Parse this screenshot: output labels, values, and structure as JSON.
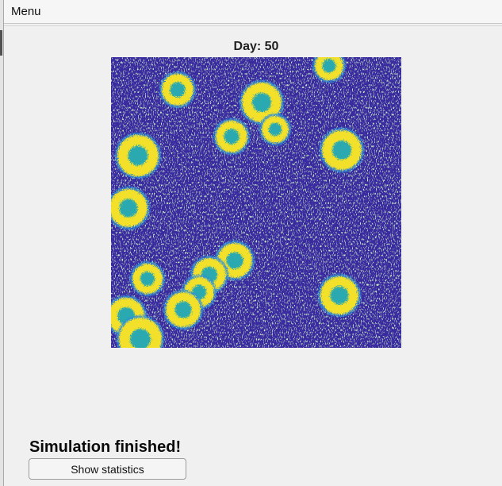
{
  "menubar": {
    "menu_label": "Menu"
  },
  "plot": {
    "title": "Day: 50",
    "colors": {
      "background": "#3a2aa0",
      "outer_halo": "#2e8fd8",
      "infected": "#f2e02c",
      "core": "#29a9b0",
      "speckle": "#7fc48c"
    }
  },
  "status": {
    "message": "Simulation finished!"
  },
  "actions": {
    "show_statistics_label": "Show statistics"
  }
}
